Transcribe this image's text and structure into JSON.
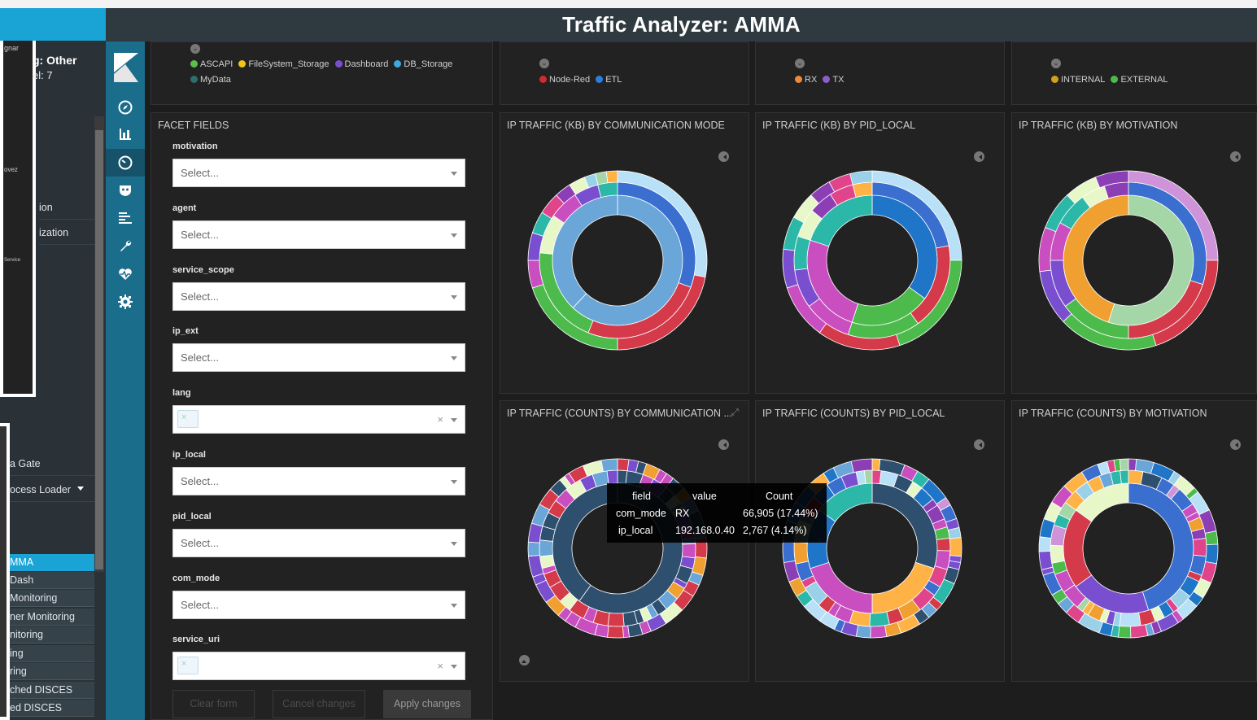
{
  "background_app": {
    "header_title": "g: Other",
    "header_sub": "el: 7",
    "nav_items": [
      "ion",
      "ization",
      "a Gate",
      "ocess Loader"
    ],
    "active_item": "MMA",
    "sub_items": [
      "Dash",
      "Monitoring",
      "ner Monitoring",
      "nitoring",
      "ing",
      "ring",
      "ched DISCES",
      "ed DISCES"
    ],
    "map_labels": [
      "gnar",
      "ovez",
      "Service"
    ]
  },
  "header": {
    "title": "Traffic Analyzer: AMMA"
  },
  "kibana_nav": {
    "icons": [
      "compass-icon",
      "bar-chart-icon",
      "dashboard-icon",
      "shield-icon",
      "timeline-icon",
      "wrench-icon",
      "heartbeat-icon",
      "gear-icon"
    ],
    "active": "dashboard-icon"
  },
  "legends": {
    "services": [
      {
        "label": "ASCAPI",
        "color": "#5bbf4a"
      },
      {
        "label": "FileSystem_Storage",
        "color": "#f0c419"
      },
      {
        "label": "Dashboard",
        "color": "#7a4fcf"
      },
      {
        "label": "DB_Storage",
        "color": "#3fa8e0"
      },
      {
        "label": "MyData",
        "color": "#2f6f6a"
      }
    ],
    "com_mode_agents": [
      {
        "label": "Node-Red",
        "color": "#d42a2a"
      },
      {
        "label": "ETL",
        "color": "#2b7fe0"
      }
    ],
    "rx_tx": [
      {
        "label": "RX",
        "color": "#f0883a"
      },
      {
        "label": "TX",
        "color": "#8b5ec9"
      }
    ],
    "motivation": [
      {
        "label": "INTERNAL",
        "color": "#d4a017"
      },
      {
        "label": "EXTERNAL",
        "color": "#4cbb4c"
      }
    ]
  },
  "facet_panel": {
    "title": "FACET FIELDS",
    "placeholder": "Select...",
    "fields": [
      {
        "label": "motivation",
        "multi": false
      },
      {
        "label": "agent",
        "multi": false
      },
      {
        "label": "service_scope",
        "multi": false
      },
      {
        "label": "ip_ext",
        "multi": false
      },
      {
        "label": "lang",
        "multi": true
      },
      {
        "label": "ip_local",
        "multi": false
      },
      {
        "label": "pid_local",
        "multi": false
      },
      {
        "label": "com_mode",
        "multi": false
      },
      {
        "label": "service_uri",
        "multi": true
      }
    ],
    "clear_label": "×",
    "buttons": {
      "clear": "Clear form",
      "cancel": "Cancel changes",
      "apply": "Apply changes"
    }
  },
  "charts": {
    "kb_com_mode": {
      "title": "IP TRAFFIC (KB) BY COMMUNICATION MODE"
    },
    "kb_pid_local": {
      "title": "IP TRAFFIC (KB) BY PID_LOCAL"
    },
    "kb_motivation": {
      "title": "IP TRAFFIC (KB) BY MOTIVATION"
    },
    "counts_com_mode": {
      "title": "IP TRAFFIC (COUNTS) BY COMMUNICATION ..."
    },
    "counts_pid_local": {
      "title": "IP TRAFFIC (COUNTS) BY PID_LOCAL"
    },
    "counts_motivation": {
      "title": "IP TRAFFIC (COUNTS) BY MOTIVATION"
    }
  },
  "tooltip": {
    "headers": [
      "field",
      "value",
      "Count"
    ],
    "rows": [
      [
        "com_mode",
        "RX",
        "66,905 (17.44%)"
      ],
      [
        "ip_local",
        "192.168.0.40",
        "2,767 (4.14%)"
      ]
    ]
  },
  "palette": {
    "donut_colors": [
      "#3a6fd0",
      "#1f75c8",
      "#b8e0f7",
      "#6ba6d8",
      "#d43a4a",
      "#4cbb4c",
      "#c94fc0",
      "#7a4fcf",
      "#2cb8a8",
      "#e8f7c8",
      "#8c3fb5",
      "#e0448a",
      "#ffb347",
      "#9ad1e8",
      "#a5d6a7",
      "#ce93d8",
      "#f0a030",
      "#2f4f6f"
    ]
  }
}
